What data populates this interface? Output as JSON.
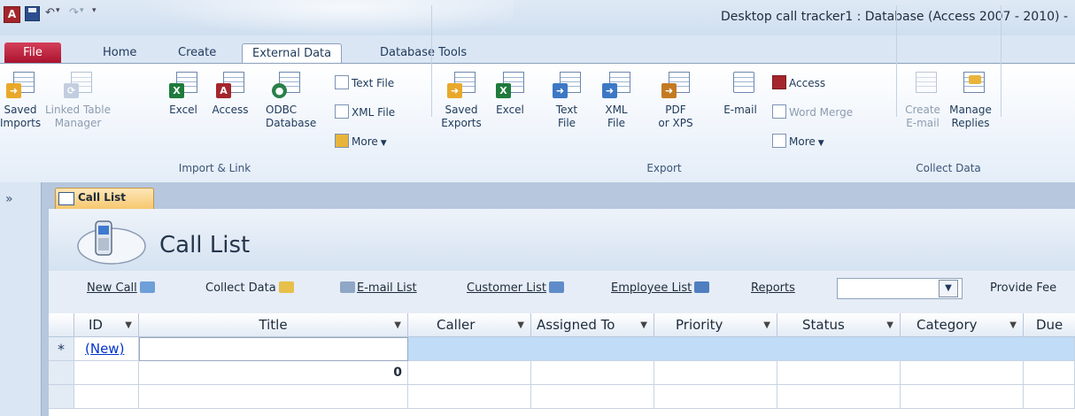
{
  "window": {
    "title": "Desktop call tracker1 : Database (Access 2007 - 2010)  -"
  },
  "qat": {
    "undo": "↶",
    "redo": "↷",
    "customize": "▾"
  },
  "tabs": [
    "File",
    "Home",
    "Create",
    "External Data",
    "Database Tools"
  ],
  "ribbon": {
    "import_link": {
      "label": "Import & Link",
      "saved_imports": [
        "Saved",
        "Imports"
      ],
      "linked_table_manager": [
        "Linked Table",
        "Manager"
      ],
      "excel": "Excel",
      "access": "Access",
      "odbc": [
        "ODBC",
        "Database"
      ],
      "text_file": "Text File",
      "xml_file": "XML File",
      "more": "More"
    },
    "export": {
      "label": "Export",
      "saved_exports": [
        "Saved",
        "Exports"
      ],
      "excel": "Excel",
      "text_file": [
        "Text",
        "File"
      ],
      "xml_file": [
        "XML",
        "File"
      ],
      "pdf": [
        "PDF",
        "or XPS"
      ],
      "email": "E-mail",
      "access": "Access",
      "word_merge": "Word Merge",
      "more": "More"
    },
    "collect": {
      "label": "Collect Data",
      "create_email": [
        "Create",
        "E-mail"
      ],
      "manage_replies": [
        "Manage",
        "Replies"
      ]
    }
  },
  "nav": {
    "toggle": "»"
  },
  "document": {
    "tab_label": "Call List",
    "form_title": "Call List",
    "commands": {
      "new_call": "New Call",
      "collect_data": "Collect Data",
      "email_list": "E-mail List",
      "customer_list": "Customer List",
      "employee_list": "Employee List",
      "reports": "Reports",
      "provide_feedback": "Provide Fee"
    },
    "columns": [
      "ID",
      "Title",
      "Caller",
      "Assigned To",
      "Priority",
      "Status",
      "Category",
      "Due"
    ],
    "new_row": {
      "marker": "*",
      "id": "(New)"
    },
    "totals_row": {
      "title_value": "0"
    }
  },
  "colors": {
    "file_tab": "#b8213a",
    "accent": "#1e395b",
    "selected_row": "#c0dcf7",
    "doc_tab": "#f6c66c"
  }
}
